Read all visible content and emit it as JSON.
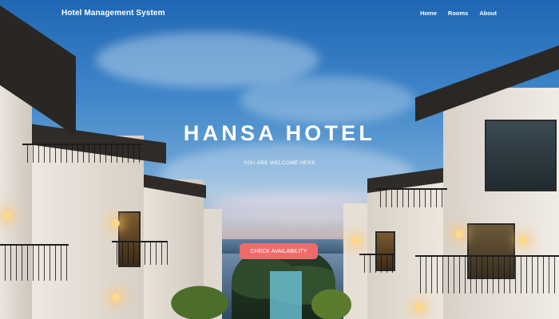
{
  "nav": {
    "brand": "Hotel Management System",
    "links": [
      {
        "label": "Home"
      },
      {
        "label": "Rooms"
      },
      {
        "label": "About"
      }
    ]
  },
  "hero": {
    "title": "HANSA HOTEL",
    "subtitle": "YOU ARE WELCOME HERE",
    "cta_label": "CHECK AVAILABILITY"
  },
  "colors": {
    "cta_background": "#f06a6a",
    "nav_text": "#ffffff"
  }
}
